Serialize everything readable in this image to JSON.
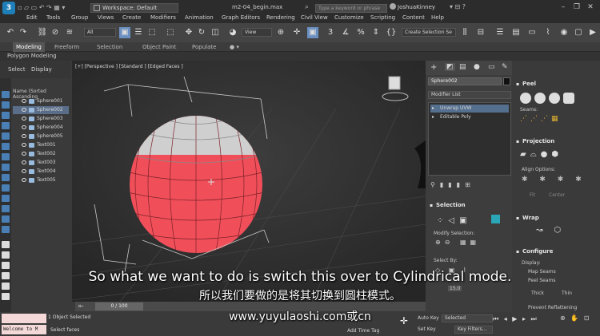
{
  "titlebar": {
    "workspace": "Workspace: Default",
    "filename": "m2-04_begin.max",
    "search_placeholder": "Type a keyword or phrase",
    "user": "JoshuaKinney"
  },
  "menu": [
    "Edit",
    "Tools",
    "Group",
    "Views",
    "Create",
    "Modifiers",
    "Animation",
    "Graph Editors",
    "Rendering",
    "Civil View",
    "Customize",
    "Scripting",
    "Content",
    "Help"
  ],
  "toolbar": {
    "filter": "All",
    "coord": "View",
    "selection_set": "Create Selection Se"
  },
  "ribbon": {
    "tabs": [
      "Modeling",
      "Freeform",
      "Selection",
      "Object Paint",
      "Populate"
    ],
    "sub": "Polygon Modeling"
  },
  "explorer": {
    "tabs": [
      "Select",
      "Display"
    ],
    "header": "Name (Sorted Ascending",
    "items": [
      {
        "name": "Sphere001",
        "selected": false
      },
      {
        "name": "Sphere002",
        "selected": true
      },
      {
        "name": "Sphere003",
        "selected": false
      },
      {
        "name": "Sphere004",
        "selected": false
      },
      {
        "name": "Sphere005",
        "selected": false
      },
      {
        "name": "Text001",
        "selected": false
      },
      {
        "name": "Text002",
        "selected": false
      },
      {
        "name": "Text003",
        "selected": false
      },
      {
        "name": "Text004",
        "selected": false
      },
      {
        "name": "Text005",
        "selected": false
      }
    ]
  },
  "viewport": {
    "label": "[+] [Perspective ] [Standard ] [Edged Faces ]"
  },
  "command_panel": {
    "object_name": "Sphere002",
    "modifier_list": "Modifier List",
    "stack": [
      "Unwrap UVW",
      "Editable Poly"
    ],
    "selection_header": "Selection",
    "modify_selection": "Modify Selection:",
    "select_by": "Select By:",
    "angle_value": "15.0"
  },
  "uv_panel": {
    "peel": "Peel",
    "seams": "Seams:",
    "projection": "Projection",
    "align_options": "Align Options:",
    "fit": "Fit",
    "center": "Center",
    "wrap": "Wrap",
    "configure": "Configure",
    "display": "Display:",
    "map_seams": "Map Seams",
    "peel_seams": "Peel Seams",
    "thick": "Thick",
    "thin": "Thin",
    "prevent": "Prevent Reflattening"
  },
  "timeline": {
    "frame": "0 / 100"
  },
  "status": {
    "maxscript": "Welcome to M",
    "objects_selected": "1 Object Selected",
    "prompt": "Select faces",
    "add_time_tag": "Add Time Tag",
    "auto_key": "Auto Key",
    "set_key": "Set Key",
    "selected": "Selected",
    "key_filters": "Key Filters..."
  },
  "subtitles": {
    "english": "So what we want to do is switch this over to Cylindrical mode.",
    "chinese": "所以我们要做的是将其切换到圆柱模式。",
    "watermark": "www.yuyulaoshi.com或cn"
  },
  "colors": {
    "accent": "#1f7fb8",
    "sphere": "#f04f5a",
    "selection": "#5a6e8a"
  }
}
